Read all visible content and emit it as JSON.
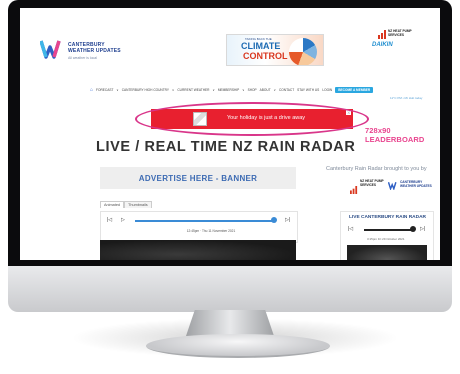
{
  "site": {
    "logo_line1": "CANTERBURY",
    "logo_line2": "WEATHER UPDATES",
    "logo_sub": "All weather is local"
  },
  "header_ads": {
    "climate_small": "TAKING BACK THE",
    "climate_big": "CLIMATE",
    "climate_big2": "CONTROL",
    "heat_pump": "NZ HEAT PUMP SERVICES",
    "daikin": "DAIKIN"
  },
  "nav": {
    "items": [
      "FORECAST",
      "CANTERBURY HIGH COUNTRY",
      "CURRENT WEATHER",
      "MEMBERSHIP",
      "SHOP",
      "ABOUT",
      "CONTACT",
      "STAY WITH US",
      "LOGIN"
    ],
    "cta": "BECOME A MEMBER",
    "note": "11°C PM • Mt Hutt today"
  },
  "banner": {
    "text": "Your holiday is just a drive away",
    "close": "X"
  },
  "annotation": {
    "leaderboard": "728x90 LEADERBOARD"
  },
  "page": {
    "title": "LIVE / REAL TIME NZ RAIN RADAR",
    "advertise": "ADVERTISE HERE - BANNER"
  },
  "player": {
    "tabs": [
      "Animated",
      "Thumbnails"
    ],
    "timestamp": "12:45pm · Thu 11 November 2021",
    "progress": 0.98
  },
  "sidebar": {
    "heading": "Canterbury Rain Radar brought to you by",
    "hp_logo": "NZ HEAT PUMP SERVICES",
    "cwu_logo": "CANTERBURY WEATHER UPDATES",
    "box_title": "LIVE CANTERBURY RAIN RADAR",
    "time": "3:15pm Fri 29 October 2021"
  },
  "colors": {
    "accent": "#2aa7e0",
    "banner": "#e8202f",
    "highlight": "#d9368a"
  }
}
